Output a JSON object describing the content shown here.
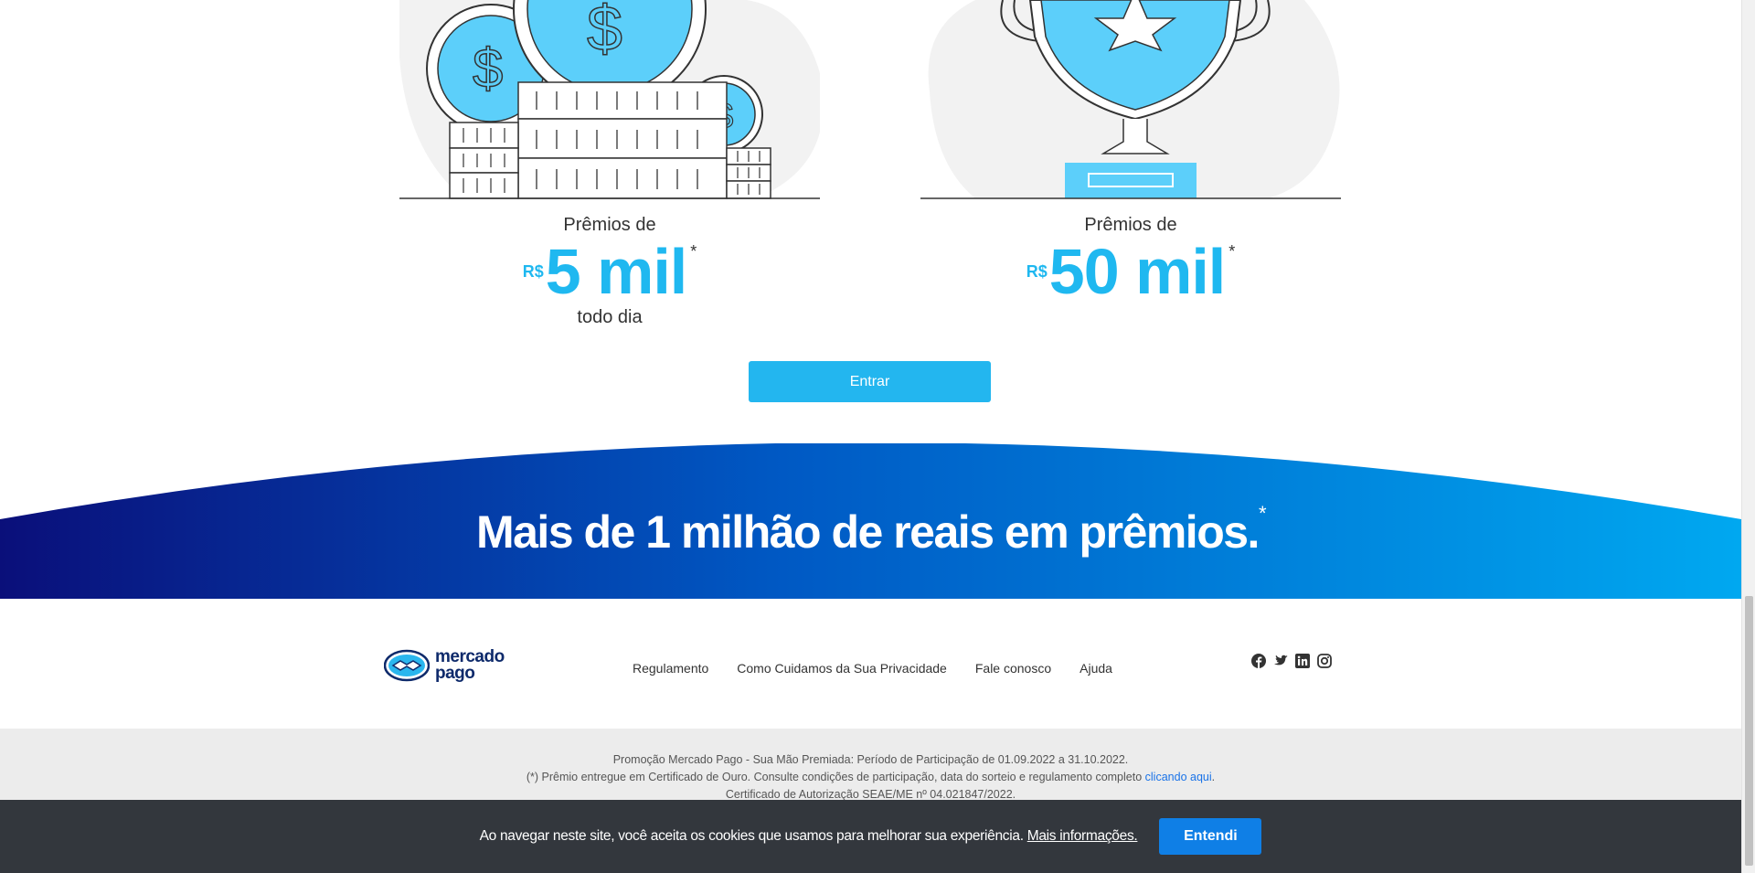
{
  "prizes": [
    {
      "caption": "Prêmios de",
      "currency": "R$",
      "value": "5 mil",
      "mark": "*",
      "sub": "todo dia",
      "illustration": "coins-illustration"
    },
    {
      "caption": "Prêmios de",
      "currency": "R$",
      "value": "50 mil",
      "mark": "*",
      "sub": "",
      "illustration": "trophy-illustration"
    }
  ],
  "enter_button": "Entrar",
  "banner": {
    "title": "Mais de 1 milhão de reais em prêmios.",
    "mark": "*"
  },
  "footer": {
    "logo_line1": "mercado",
    "logo_line2": "pago",
    "links": [
      "Regulamento",
      "Como Cuidamos da Sua Privacidade",
      "Fale conosco",
      "Ajuda"
    ],
    "social": [
      "facebook-icon",
      "twitter-icon",
      "linkedin-icon",
      "instagram-icon"
    ]
  },
  "legal": {
    "line1": "Promoção Mercado Pago - Sua Mão Premiada: Período de Participação de 01.09.2022 a 31.10.2022.",
    "line2": "(*) Prêmio entregue em Certificado de Ouro. Consulte condições de participação, data do sorteio e regulamento completo",
    "line2_link": "clicando aqui",
    "line3": "Certificado de Autorização SEAE/ME nº 04.021847/2022."
  },
  "cookie": {
    "text": "Ao navegar neste site, você aceita os cookies que usamos para melhorar sua experiência.",
    "link": "Mais informações.",
    "button": "Entendi"
  },
  "colors": {
    "accent": "#1fb8f0",
    "banner_start": "#0a0f7a",
    "banner_end": "#00a8f0",
    "cookie_bar": "#33373d",
    "cookie_button": "#0f7fe6"
  }
}
